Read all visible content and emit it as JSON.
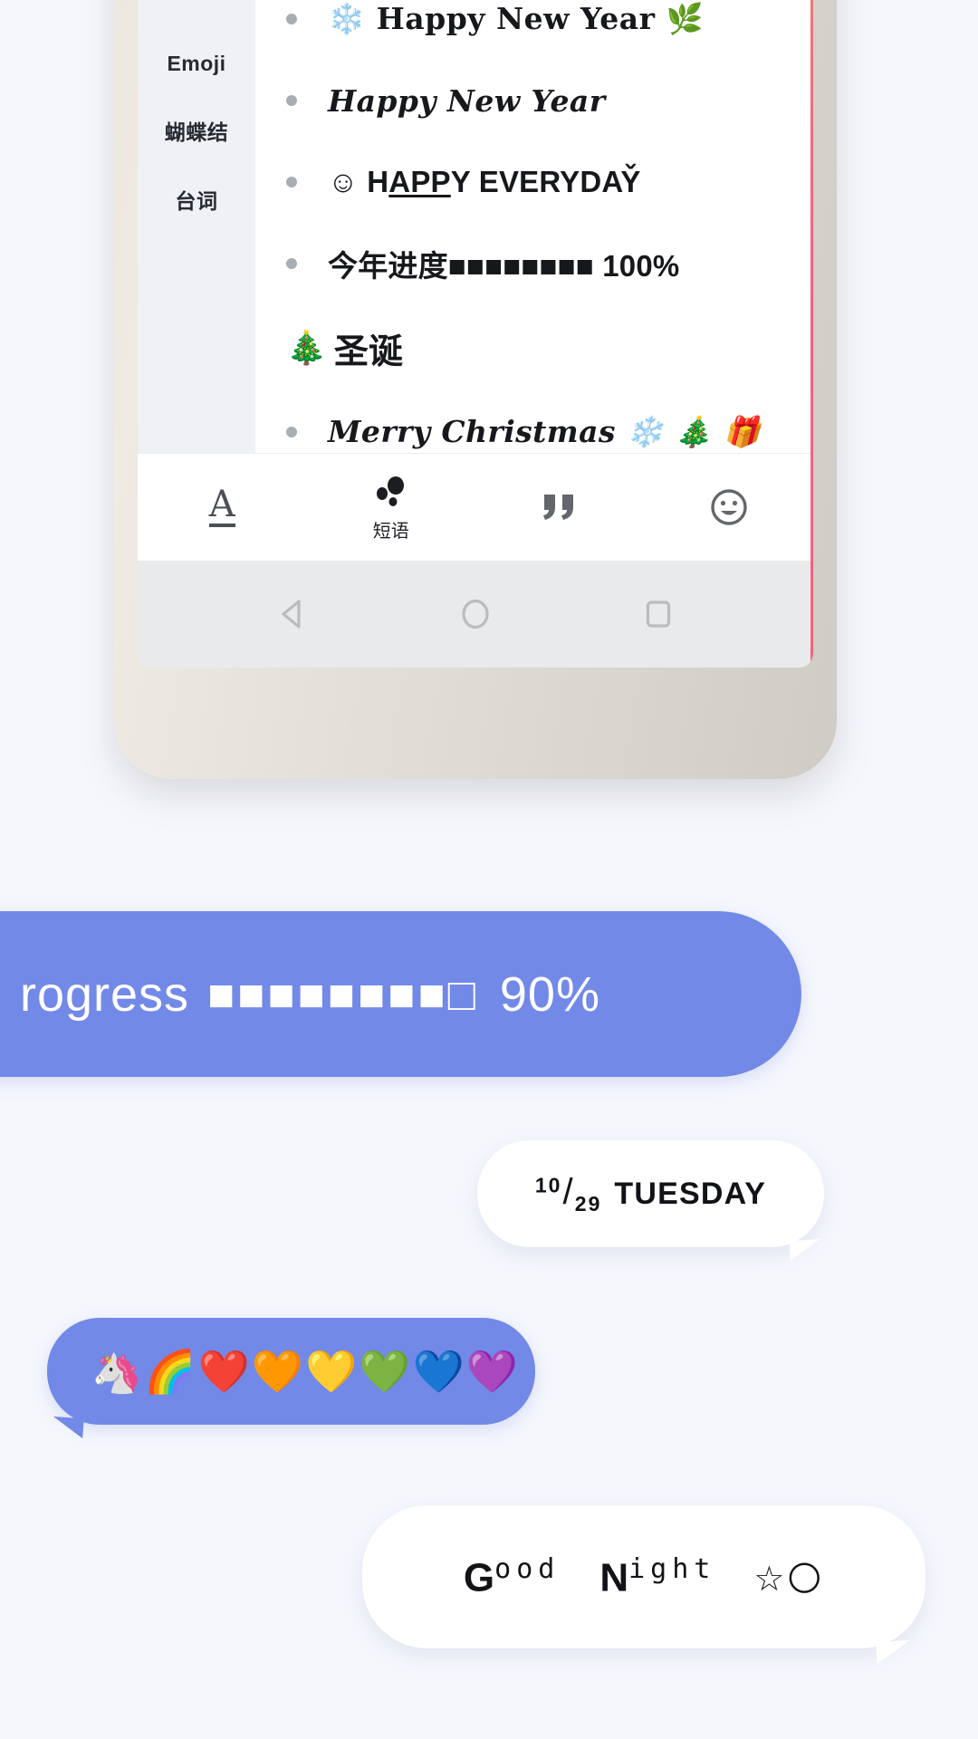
{
  "phone": {
    "sidebar": {
      "items": [
        {
          "label": "Emoji"
        },
        {
          "label": "蝴蝶结"
        },
        {
          "label": "台词"
        }
      ]
    },
    "phrases": [
      {
        "type": "item",
        "style": "slab",
        "text": "❄️ Happy New Year 🌿"
      },
      {
        "type": "item",
        "style": "script",
        "text": "Happy New Year"
      },
      {
        "type": "item",
        "style": "bold",
        "prefix": "☺ H",
        "underline": "APP",
        "suffix": "Y EVERYDAY̌"
      },
      {
        "type": "item",
        "style": "bold",
        "text": "今年进度■■■■■■■■ 100%"
      },
      {
        "type": "header",
        "emoji": "🎄",
        "text": "圣诞"
      },
      {
        "type": "item",
        "style": "script",
        "text": "Merry Christmas ❄️ 🎄 🎁"
      }
    ],
    "toolbar": [
      {
        "icon": "text-format-icon",
        "glyph": "A",
        "label": ""
      },
      {
        "icon": "phrases-icon",
        "glyph": "",
        "label": "短语"
      },
      {
        "icon": "quote-icon",
        "glyph": "”",
        "label": ""
      },
      {
        "icon": "emoji-face-icon",
        "glyph": "",
        "label": ""
      }
    ],
    "navbar": [
      {
        "icon": "back-triangle-icon"
      },
      {
        "icon": "home-circle-icon"
      },
      {
        "icon": "recents-square-icon"
      }
    ]
  },
  "chat": {
    "bubbles": [
      {
        "id": "progress",
        "side": "left",
        "color": "#7289e8",
        "label_text": "rogress",
        "bar_filled": "■■■■■■■■",
        "bar_empty": "□",
        "percent": "90%"
      },
      {
        "id": "date",
        "side": "right",
        "color": "#ffffff",
        "month": "10",
        "separator": "/",
        "day": "29",
        "weekday": "TUESDAY"
      },
      {
        "id": "emoji",
        "side": "left",
        "color": "#7289e8",
        "emojis": "🦄🌈❤️🧡💛💚💙💜"
      },
      {
        "id": "night",
        "side": "right",
        "color": "#ffffff",
        "word1_big": "G",
        "word1_small": "ood",
        "word2_big": "N",
        "word2_small": "ight",
        "trailing_emoji": "☆🌕"
      }
    ]
  },
  "colors": {
    "page_background": "#f5f7fd",
    "bubble_blue": "#7289e8",
    "bubble_white": "#ffffff",
    "phone_frame": "#e8e2da",
    "sidebar_bg": "#f0f1f4",
    "navbar_bg": "#e9eaec"
  }
}
